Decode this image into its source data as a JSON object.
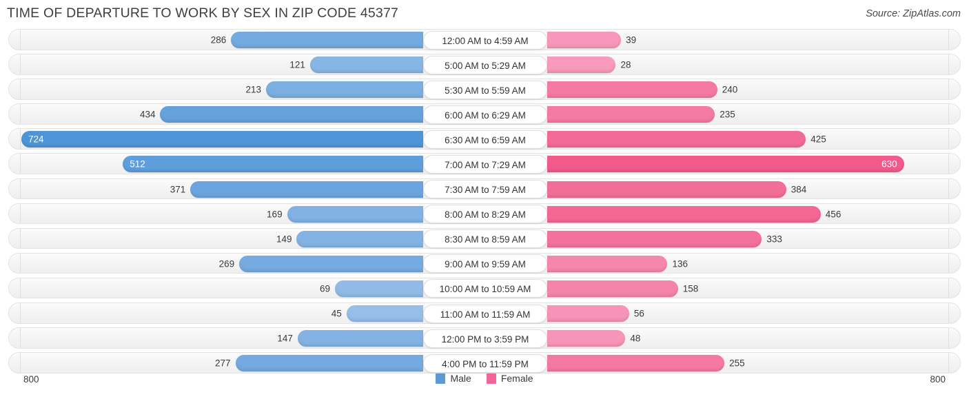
{
  "header": {
    "title": "TIME OF DEPARTURE TO WORK BY SEX IN ZIP CODE 45377",
    "source": "Source: ZipAtlas.com"
  },
  "legend": {
    "male_label": "Male",
    "female_label": "Female",
    "male_color": "#5b9bd5",
    "female_color": "#f2659a"
  },
  "axis": {
    "left_label": "800",
    "right_label": "800",
    "max": 800
  },
  "chart_data": {
    "type": "bar",
    "subtype": "diverging-bidirectional-bar",
    "title": "TIME OF DEPARTURE TO WORK BY SEX IN ZIP CODE 45377",
    "xlabel": "",
    "ylabel": "",
    "xlim": [
      800,
      800
    ],
    "grid": false,
    "legend_position": "bottom-center",
    "categories": [
      "12:00 AM to 4:59 AM",
      "5:00 AM to 5:29 AM",
      "5:30 AM to 5:59 AM",
      "6:00 AM to 6:29 AM",
      "6:30 AM to 6:59 AM",
      "7:00 AM to 7:29 AM",
      "7:30 AM to 7:59 AM",
      "8:00 AM to 8:29 AM",
      "8:30 AM to 8:59 AM",
      "9:00 AM to 9:59 AM",
      "10:00 AM to 10:59 AM",
      "11:00 AM to 11:59 AM",
      "12:00 PM to 3:59 PM",
      "4:00 PM to 11:59 PM"
    ],
    "series": [
      {
        "name": "Male",
        "direction": "left",
        "color": "#5b9bd5",
        "values": [
          286,
          121,
          213,
          434,
          724,
          512,
          371,
          169,
          149,
          269,
          69,
          45,
          147,
          277
        ]
      },
      {
        "name": "Female",
        "direction": "right",
        "color": "#f2659a",
        "values": [
          39,
          28,
          240,
          235,
          425,
          630,
          384,
          456,
          333,
          136,
          158,
          56,
          48,
          255
        ]
      }
    ]
  },
  "rows": [
    {
      "label": "12:00 AM to 4:59 AM",
      "male": "286",
      "female": "39"
    },
    {
      "label": "5:00 AM to 5:29 AM",
      "male": "121",
      "female": "28"
    },
    {
      "label": "5:30 AM to 5:59 AM",
      "male": "213",
      "female": "240"
    },
    {
      "label": "6:00 AM to 6:29 AM",
      "male": "434",
      "female": "235"
    },
    {
      "label": "6:30 AM to 6:59 AM",
      "male": "724",
      "female": "425"
    },
    {
      "label": "7:00 AM to 7:29 AM",
      "male": "512",
      "female": "630"
    },
    {
      "label": "7:30 AM to 7:59 AM",
      "male": "371",
      "female": "384"
    },
    {
      "label": "8:00 AM to 8:29 AM",
      "male": "169",
      "female": "456"
    },
    {
      "label": "8:30 AM to 8:59 AM",
      "male": "149",
      "female": "333"
    },
    {
      "label": "9:00 AM to 9:59 AM",
      "male": "269",
      "female": "136"
    },
    {
      "label": "10:00 AM to 10:59 AM",
      "male": "69",
      "female": "158"
    },
    {
      "label": "11:00 AM to 11:59 AM",
      "male": "45",
      "female": "56"
    },
    {
      "label": "12:00 PM to 3:59 PM",
      "male": "147",
      "female": "48"
    },
    {
      "label": "4:00 PM to 11:59 PM",
      "male": "277",
      "female": "255"
    }
  ]
}
